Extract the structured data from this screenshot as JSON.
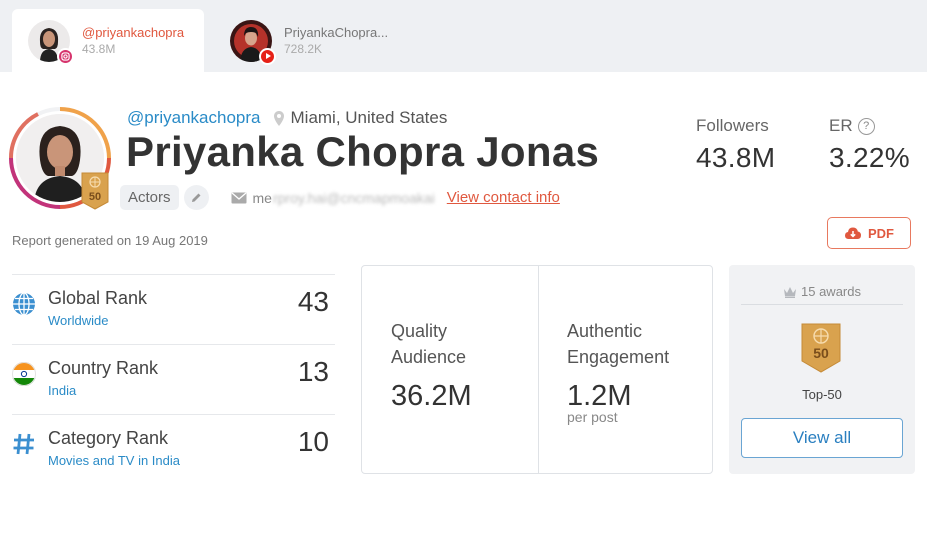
{
  "tabs": [
    {
      "name": "@priyankachopra",
      "count": "43.8M",
      "platform": "instagram"
    },
    {
      "name": "PriyankaChopra...",
      "count": "728.2K",
      "platform": "youtube"
    }
  ],
  "profile": {
    "handle": "@priyankachopra",
    "location": "Miami, United States",
    "full_name": "Priyanka Chopra Jonas",
    "category_tag": "Actors",
    "email_visible": "me",
    "email_blurred": "rproy.hai@cncmapmoakai",
    "contact_link": "View contact info",
    "rank_badge": "50"
  },
  "stats": {
    "followers_label": "Followers",
    "followers_value": "43.8M",
    "er_label": "ER",
    "er_help": "?",
    "er_value": "3.22%"
  },
  "report": {
    "generated": "Report generated on 19 Aug 2019",
    "pdf_label": "PDF"
  },
  "ranks": [
    {
      "title": "Global Rank",
      "sub": "Worldwide",
      "value": "43",
      "icon": "globe-icon"
    },
    {
      "title": "Country Rank",
      "sub": "India",
      "value": "13",
      "icon": "india-flag-icon"
    },
    {
      "title": "Category Rank",
      "sub": "Movies and TV in India",
      "value": "10",
      "icon": "hash-icon"
    }
  ],
  "metrics": {
    "quality_label": "Quality Audience",
    "quality_value": "36.2M",
    "engagement_label": "Authentic Engagement",
    "engagement_value": "1.2M",
    "engagement_sub": "per post"
  },
  "awards": {
    "count_label": "15 awards",
    "badge": "50",
    "badge_label": "Top-50",
    "view_all": "View all"
  },
  "colors": {
    "accent_orange": "#e0583f",
    "link_blue": "#2a8bc7",
    "badge_gold": "#d9a24e"
  }
}
